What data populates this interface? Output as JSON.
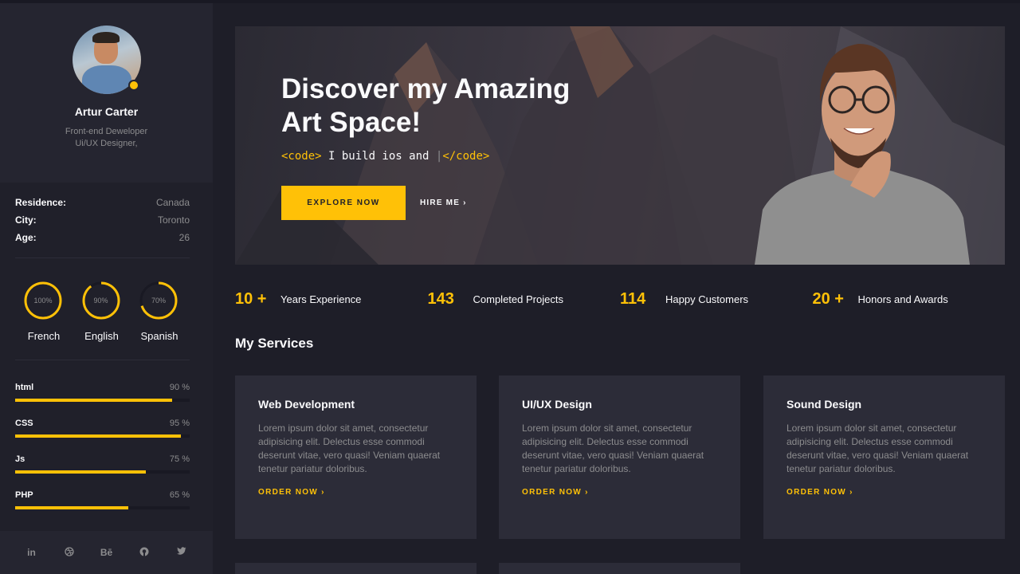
{
  "profile": {
    "name": "Artur Carter",
    "role_line1": "Front-end Deweloper",
    "role_line2": "Ui/UX Designer,"
  },
  "info": [
    {
      "key": "Residence:",
      "value": "Canada"
    },
    {
      "key": "City:",
      "value": "Toronto"
    },
    {
      "key": "Age:",
      "value": "26"
    }
  ],
  "languages": [
    {
      "label": "French",
      "percent_text": "100%",
      "percent": 100
    },
    {
      "label": "English",
      "percent_text": "90%",
      "percent": 90
    },
    {
      "label": "Spanish",
      "percent_text": "70%",
      "percent": 70
    }
  ],
  "skills": [
    {
      "label": "html",
      "value_text": "90 %",
      "percent": 90
    },
    {
      "label": "CSS",
      "value_text": "95 %",
      "percent": 95
    },
    {
      "label": "Js",
      "value_text": "75 %",
      "percent": 75
    },
    {
      "label": "PHP",
      "value_text": "65 %",
      "percent": 65
    }
  ],
  "social": {
    "linkedin": "in",
    "behance": "Bē",
    "icons": [
      "linkedin-icon",
      "dribbble-icon",
      "behance-icon",
      "github-icon",
      "twitter-icon"
    ]
  },
  "hero": {
    "title_line1": "Discover my Amazing",
    "title_line2": "Art Space!",
    "code_open": "<code>",
    "code_text": " I build ios and ",
    "code_close": "</code>",
    "explore_label": "EXPLORE NOW",
    "hire_label": "HIRE ME"
  },
  "stats": [
    {
      "num": "10 +",
      "text": "Years Experience"
    },
    {
      "num": "143",
      "text": "Completed Projects"
    },
    {
      "num": "114",
      "text": "Happy Customers"
    },
    {
      "num": "20 +",
      "text": "Honors and Awards"
    }
  ],
  "services": {
    "title": "My Services",
    "cards": [
      {
        "title": "Web Development",
        "text": "Lorem ipsum dolor sit amet, consectetur adipisicing elit. Delectus esse commodi deserunt vitae, vero quasi! Veniam quaerat tenetur pariatur doloribus.",
        "link": "ORDER NOW"
      },
      {
        "title": "UI/UX Design",
        "text": "Lorem ipsum dolor sit amet, consectetur adipisicing elit. Delectus esse commodi deserunt vitae, vero quasi! Veniam quaerat tenetur pariatur doloribus.",
        "link": "ORDER NOW"
      },
      {
        "title": "Sound Design",
        "text": "Lorem ipsum dolor sit amet, consectetur adipisicing elit. Delectus esse commodi deserunt vitae, vero quasi! Veniam quaerat tenetur pariatur doloribus.",
        "link": "ORDER NOW"
      }
    ]
  },
  "colors": {
    "accent": "#ffc107",
    "background": "#1e1e28",
    "sidebar": "#20202a",
    "card": "#2c2c38",
    "muted_text": "#8c8c8e"
  }
}
